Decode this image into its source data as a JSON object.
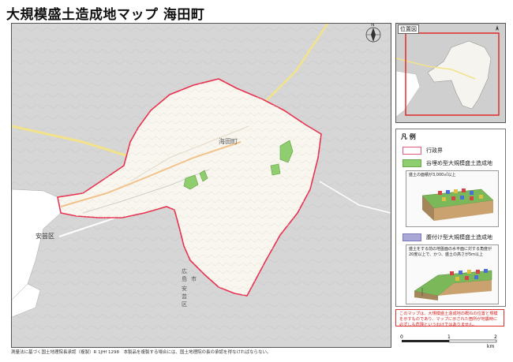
{
  "title": "大規模盛土造成地マップ 海田町",
  "credit": "測量法に基づく国土地理院長承認（複製）R 1JHf 1298　本製品を複製する場合には、国土地理院の長の承認を得なければならない。",
  "map": {
    "town_label": "海田町",
    "labels": {
      "aki_ward": "安芸区",
      "aki_ward_vertical": [
        "広",
        "島",
        "市",
        "安",
        "芸",
        "区"
      ]
    },
    "colors": {
      "town_fill": "#f8f6ef",
      "outside": "#d6d6d6",
      "boundary": "#e8304f",
      "water": "#ffffff",
      "valley_fill": "#8fce6e"
    },
    "valley_fill_count": 4
  },
  "inset": {
    "label": "位置図",
    "frame_color": "#e02020"
  },
  "legend": {
    "title": "凡 例",
    "items": [
      {
        "key": "admin",
        "label": "行政界"
      },
      {
        "key": "valley",
        "label": "谷埋め型大規模盛土造成地"
      },
      {
        "key": "side",
        "label": "腹付け型大規模盛土造成地"
      }
    ],
    "valley_diagram_caption": "盛土の面積が3,000㎡以上",
    "side_diagram_caption_1": "盛土をする前の地盤面の水平面に対する角度が",
    "side_diagram_caption_2": "20度以上で、かつ、盛土の高さが5m以上"
  },
  "note": "このマップは、大規模盛土造成地の概ねの位置と規模を示すものであり、マップに示された箇所が地震時に必ずしも危険というわけではありません。",
  "scale": {
    "ticks": [
      "0",
      "1",
      "2"
    ],
    "unit": "km"
  },
  "north_label": "N"
}
